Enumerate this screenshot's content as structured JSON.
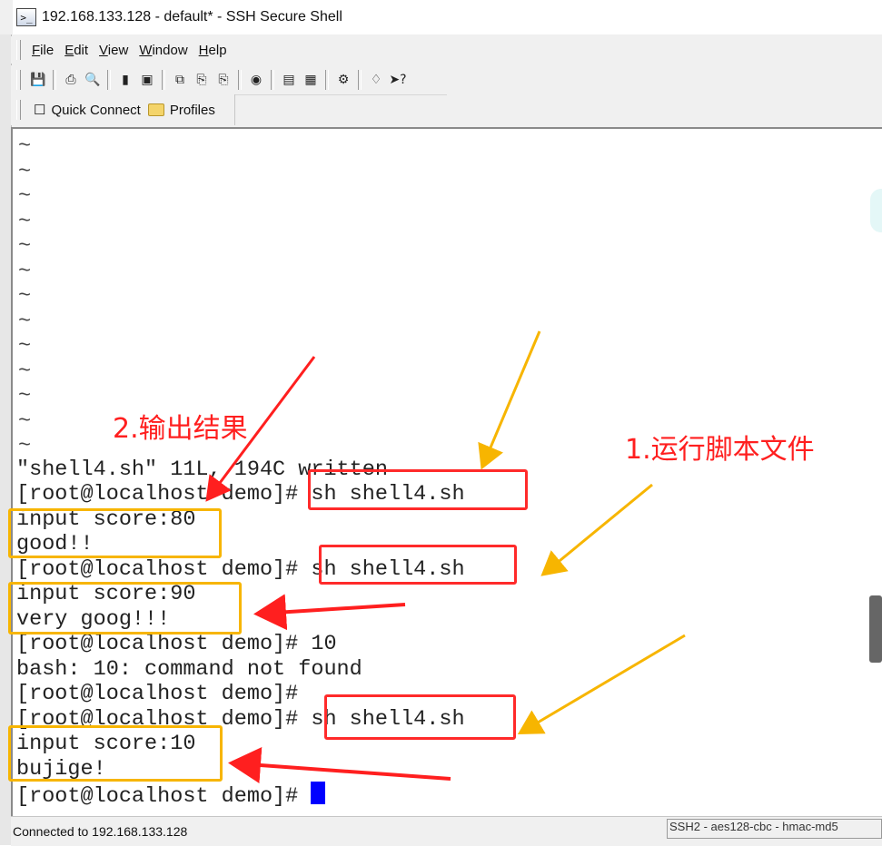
{
  "window": {
    "title": "192.168.133.128 - default* - SSH Secure Shell"
  },
  "menu": {
    "items": [
      "File",
      "Edit",
      "View",
      "Window",
      "Help"
    ]
  },
  "toolbar": {
    "icons": [
      "save-icon",
      "print-icon",
      "print-preview-icon",
      "disconnect-icon",
      "connect-icon",
      "copy-icon",
      "paste-icon",
      "paste-all-icon",
      "find-icon",
      "settings-icon",
      "profile-settings-icon",
      "sftp-icon",
      "help-book-icon",
      "context-help-icon"
    ]
  },
  "profilebar": {
    "quick_connect": "Quick Connect",
    "profiles": "Profiles"
  },
  "terminal": {
    "tildes": [
      "~",
      "~",
      "~",
      "~",
      "~",
      "~",
      "~",
      "~",
      "~",
      "~",
      "~",
      "~",
      "~"
    ],
    "lines": [
      "\"shell4.sh\" 11L, 194C written",
      "[root@localhost demo]# sh shell4.sh",
      "input score:80",
      "good!!",
      "[root@localhost demo]# sh shell4.sh",
      "input score:90",
      "very goog!!!",
      "[root@localhost demo]# 10",
      "bash: 10: command not found",
      "[root@localhost demo]#",
      "[root@localhost demo]# sh shell4.sh",
      "input score:10",
      "bujige!",
      "[root@localhost demo]# "
    ]
  },
  "annotations": {
    "label_run": "1.运行脚本文件",
    "label_output": "2.输出结果",
    "red_color": "#ff1f1f",
    "orange_color": "#f7b500"
  },
  "status": {
    "left": "Connected to 192.168.133.128",
    "right": "SSH2 - aes128-cbc - hmac-md5"
  }
}
